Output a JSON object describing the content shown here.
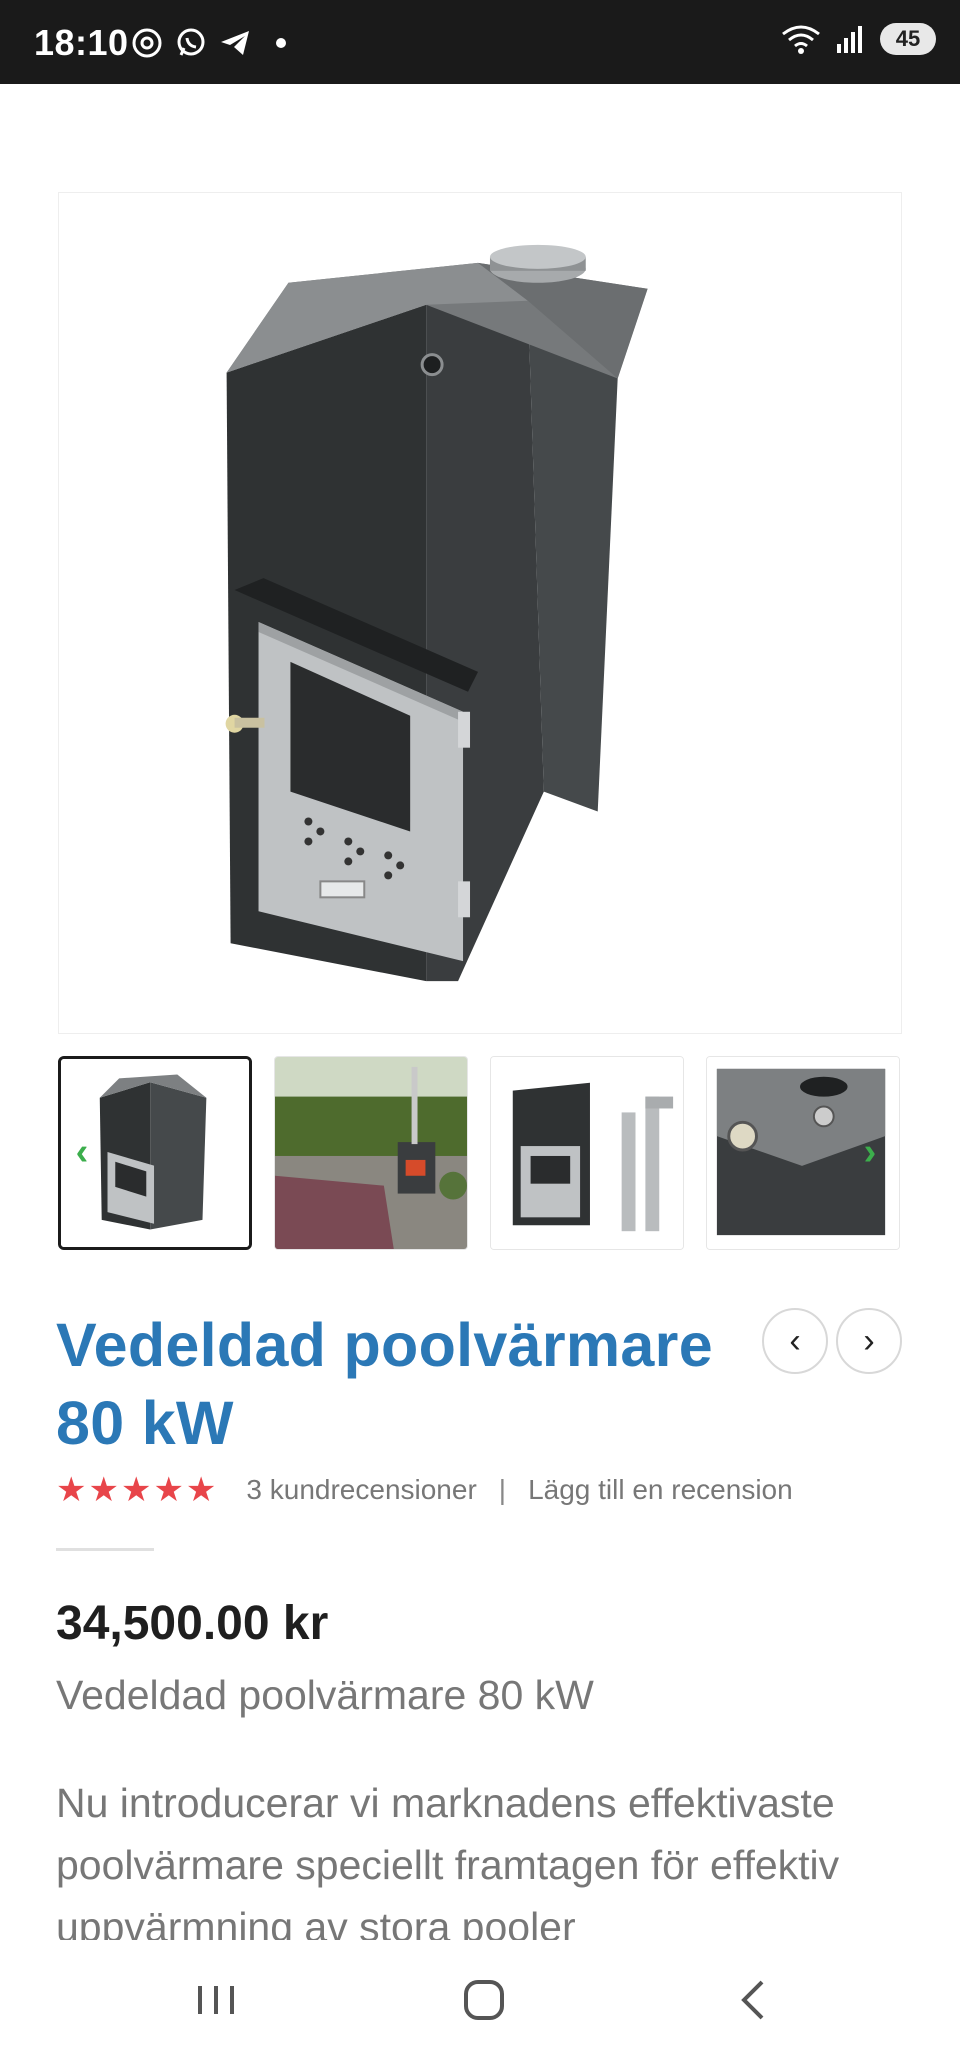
{
  "status_bar": {
    "time": "18:10",
    "left_icons": [
      "threads-icon",
      "whatsapp-icon",
      "telegram-icon",
      "notification-dot-icon"
    ],
    "right_icons": [
      "wifi-icon",
      "signal-icon"
    ],
    "wifi_label": "5",
    "battery": "45"
  },
  "product": {
    "title": "Vedeldad poolvärmare 80 kW",
    "rating_stars": "★★★★★",
    "rating_value": 5,
    "review_count": "3 kundrecensioner",
    "separator": "|",
    "add_review": "Lägg till en recension",
    "price": "34,500.00 kr",
    "subtitle": "Vedeldad poolvärmare 80 kW",
    "description": "Nu introducerar vi marknadens effektivaste poolvärmare speciellt framtagen för effektiv uppvärmning av stora pooler"
  },
  "navigation": {
    "prev_label": "‹",
    "next_label": "›",
    "thumb_prev": "‹",
    "thumb_next": "›"
  },
  "system_nav": [
    "recent-apps-icon",
    "home-icon",
    "back-icon"
  ],
  "colors": {
    "title": "#2b78b6",
    "stars": "#e8454a",
    "thumb_arrow": "#3cae4c",
    "status_bar_bg": "#1a1a1a"
  }
}
